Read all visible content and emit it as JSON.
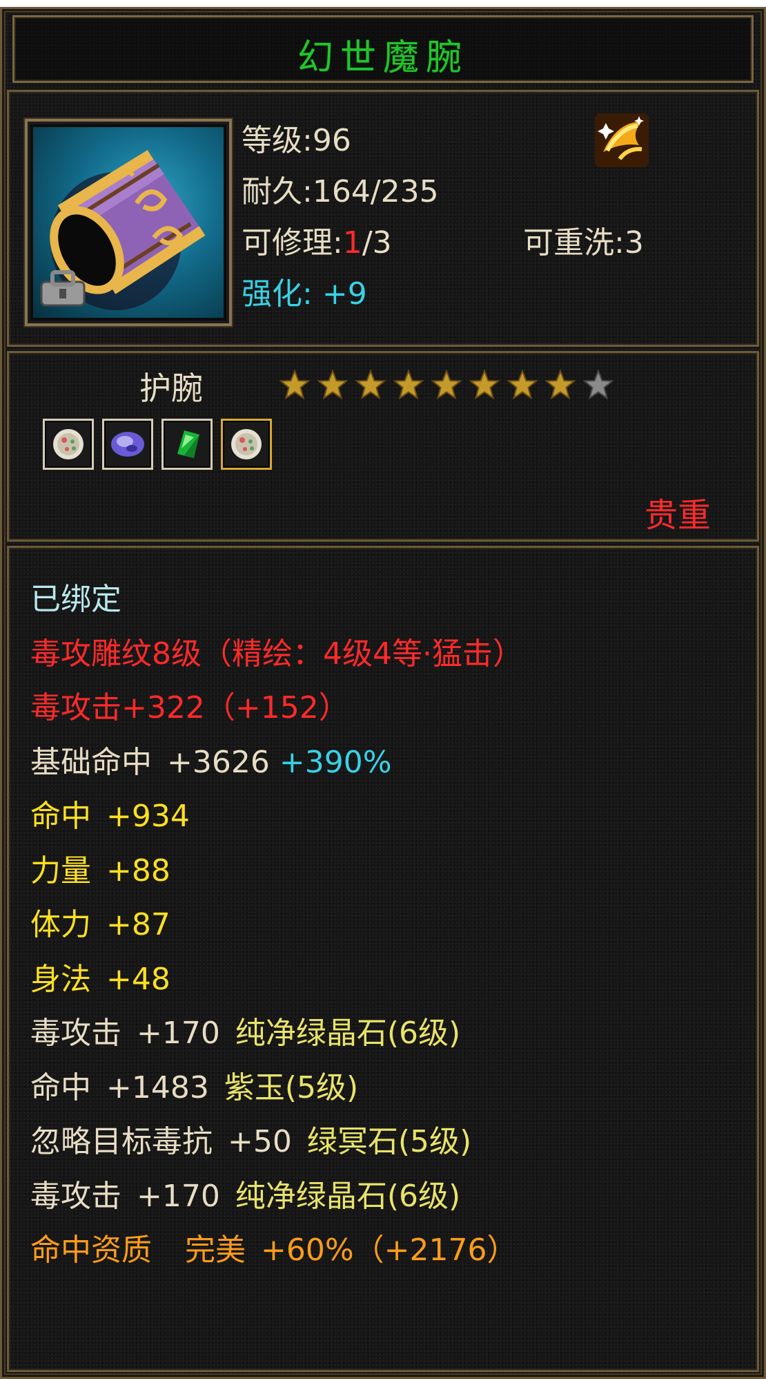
{
  "item": {
    "name": "幻世魔腕",
    "type": "护腕",
    "rarity": "贵重",
    "icon": "purple-gold-bracer-icon"
  },
  "stats": {
    "level_label": "等级:",
    "level": "96",
    "durability_label": "耐久:",
    "durability": "164/235",
    "repair_label": "可修理:",
    "repair_used": "1",
    "repair_max": "/3",
    "rewash_label": "可重洗:",
    "rewash": "3",
    "enhance_label": "强化:",
    "enhance": "+9"
  },
  "stars": {
    "filled": 8,
    "total": 9
  },
  "gems": [
    "white-gem-icon",
    "purple-gem-icon",
    "green-gem-icon",
    "white-gem-icon"
  ],
  "attributes": {
    "bound": "已绑定",
    "engrave": "毒攻雕纹8级（精绘：4级4等·猛击）",
    "poison_attack": "毒攻击+322（+152）",
    "base_hit_label": "基础命中",
    "base_hit_value": "+3626",
    "base_hit_pct": "+390%",
    "hit": {
      "label": "命中",
      "value": "+934"
    },
    "strength": {
      "label": "力量",
      "value": "+88"
    },
    "stamina": {
      "label": "体力",
      "value": "+87"
    },
    "agility": {
      "label": "身法",
      "value": "+48"
    },
    "gem_lines": [
      {
        "label": "毒攻击",
        "value": "+170",
        "gem": "纯净绿晶石(6级)"
      },
      {
        "label": "命中",
        "value": "+1483",
        "gem": "紫玉(5级)"
      },
      {
        "label": "忽略目标毒抗",
        "value": "+50",
        "gem": "绿冥石(5级)"
      },
      {
        "label": "毒攻击",
        "value": "+170",
        "gem": "纯净绿晶石(6级)"
      }
    ],
    "aptitude_label": "命中资质",
    "aptitude_quality": "完美",
    "aptitude_value": "+60%（+2176）"
  },
  "colors": {
    "title": "#22c52c",
    "red": "#ff2a2a",
    "cyan": "#38d2e6",
    "yellow": "#ffe020",
    "orange": "#ff9c1a",
    "border": "#6d5a3a"
  }
}
